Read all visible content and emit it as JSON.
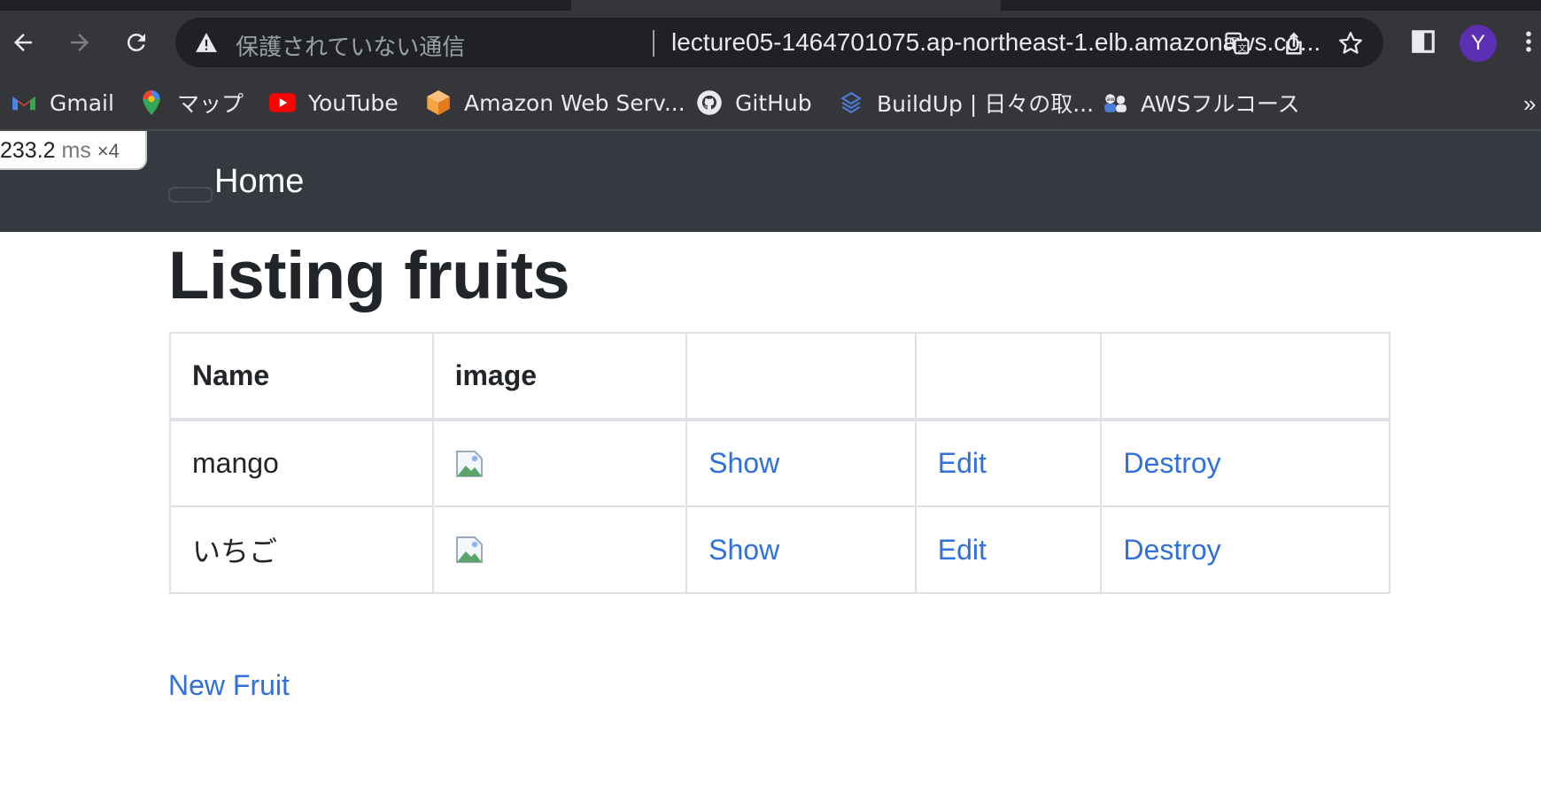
{
  "browser": {
    "security_text": "保護されていない通信",
    "url": "lecture05-1464701075.ap-northeast-1.elb.amazonaws.co...",
    "avatar_letter": "Y",
    "bookmarks": [
      {
        "label": "Gmail",
        "icon": "gmail-icon"
      },
      {
        "label": "マップ",
        "icon": "maps-pin-icon"
      },
      {
        "label": "YouTube",
        "icon": "youtube-icon"
      },
      {
        "label": "Amazon Web Serv...",
        "icon": "aws-cube-icon"
      },
      {
        "label": "GitHub",
        "icon": "github-icon"
      },
      {
        "label": "BuildUp | 日々の取...",
        "icon": "buildup-icon"
      },
      {
        "label": "AWSフルコース",
        "icon": "aws-course-icon"
      }
    ],
    "more_bookmarks": "»"
  },
  "perf_overlay": {
    "value": "233.2",
    "unit": "ms",
    "multiplier": "×4"
  },
  "navbar": {
    "home_label": "Home"
  },
  "page": {
    "title": "Listing fruits",
    "table": {
      "headers": [
        "Name",
        "image",
        "",
        "",
        ""
      ],
      "rows": [
        {
          "name": "mango",
          "show": "Show",
          "edit": "Edit",
          "destroy": "Destroy"
        },
        {
          "name": "いちご",
          "show": "Show",
          "edit": "Edit",
          "destroy": "Destroy"
        }
      ]
    },
    "new_link": "New Fruit"
  },
  "colors": {
    "link": "#2f6fde",
    "navbar": "#343a40",
    "chrome": "#35363a"
  }
}
